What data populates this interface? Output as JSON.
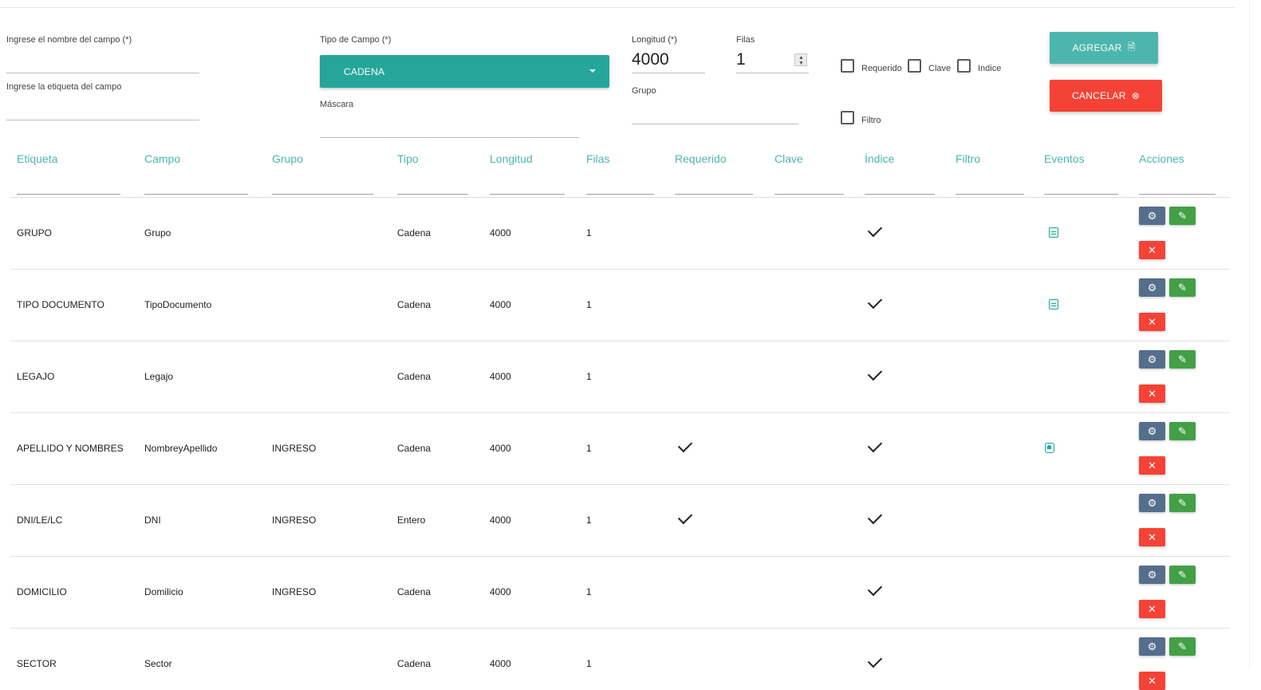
{
  "form": {
    "nombre": {
      "label": "Ingrese el nombre del campo (*)",
      "value": ""
    },
    "etiqueta": {
      "label": "Ingrese la etiqueta del campo",
      "value": ""
    },
    "tipo": {
      "label": "Tipo de Campo (*)",
      "selected": "CADENA"
    },
    "mascara": {
      "label": "Máscara",
      "value": ""
    },
    "longitud": {
      "label": "Longitud (*)",
      "value": "4000"
    },
    "filas": {
      "label": "Filas",
      "value": "1"
    },
    "grupo": {
      "label": "Grupo",
      "value": ""
    },
    "checkboxes": {
      "requerido": {
        "label": "Requerido",
        "checked": false
      },
      "clave": {
        "label": "Clave",
        "checked": false
      },
      "indice": {
        "label": "Indice",
        "checked": false
      },
      "filtro": {
        "label": "Filtro",
        "checked": false
      }
    },
    "agregar_label": "AGREGAR",
    "cancelar_label": "CANCELAR"
  },
  "table": {
    "headers": {
      "etiqueta": "Etiqueta",
      "campo": "Campo",
      "grupo": "Grupo",
      "tipo": "Tipo",
      "longitud": "Longitud",
      "filas": "Filas",
      "requerido": "Requerido",
      "clave": "Clave",
      "indice": "Índice",
      "filtro": "Filtro",
      "eventos": "Eventos",
      "acciones": "Acciones"
    },
    "rows": [
      {
        "etiqueta": "GRUPO",
        "campo": "Grupo",
        "grupo": "",
        "tipo": "Cadena",
        "longitud": "4000",
        "filas": "1",
        "requerido": false,
        "clave": false,
        "indice": true,
        "filtro": false,
        "evento": "document-icon"
      },
      {
        "etiqueta": "TIPO DOCUMENTO",
        "campo": "TipoDocumento",
        "grupo": "",
        "tipo": "Cadena",
        "longitud": "4000",
        "filas": "1",
        "requerido": false,
        "clave": false,
        "indice": true,
        "filtro": false,
        "evento": "document-icon"
      },
      {
        "etiqueta": "LEGAJO",
        "campo": "Legajo",
        "grupo": "",
        "tipo": "Cadena",
        "longitud": "4000",
        "filas": "1",
        "requerido": false,
        "clave": false,
        "indice": true,
        "filtro": false,
        "evento": ""
      },
      {
        "etiqueta": "APELLIDO Y NOMBRES",
        "campo": "NombreyApellido",
        "grupo": "INGRESO",
        "tipo": "Cadena",
        "longitud": "4000",
        "filas": "1",
        "requerido": true,
        "clave": false,
        "indice": true,
        "filtro": false,
        "evento": "bell-icon"
      },
      {
        "etiqueta": "DNI/LE/LC",
        "campo": "DNI",
        "grupo": "INGRESO",
        "tipo": "Entero",
        "longitud": "4000",
        "filas": "1",
        "requerido": true,
        "clave": false,
        "indice": true,
        "filtro": false,
        "evento": ""
      },
      {
        "etiqueta": "DOMICILIO",
        "campo": "Domilicio",
        "grupo": "INGRESO",
        "tipo": "Cadena",
        "longitud": "4000",
        "filas": "1",
        "requerido": false,
        "clave": false,
        "indice": true,
        "filtro": false,
        "evento": ""
      },
      {
        "etiqueta": "SECTOR",
        "campo": "Sector",
        "grupo": "",
        "tipo": "Cadena",
        "longitud": "4000",
        "filas": "1",
        "requerido": false,
        "clave": false,
        "indice": true,
        "filtro": false,
        "evento": ""
      }
    ]
  },
  "colors": {
    "accent": "#26a69a",
    "header_text": "#4db6ac",
    "add_button": "#4db6ac",
    "cancel_button": "#f44336",
    "gear_button": "#546e8c",
    "edit_button": "#43a047",
    "delete_button": "#f44336"
  }
}
